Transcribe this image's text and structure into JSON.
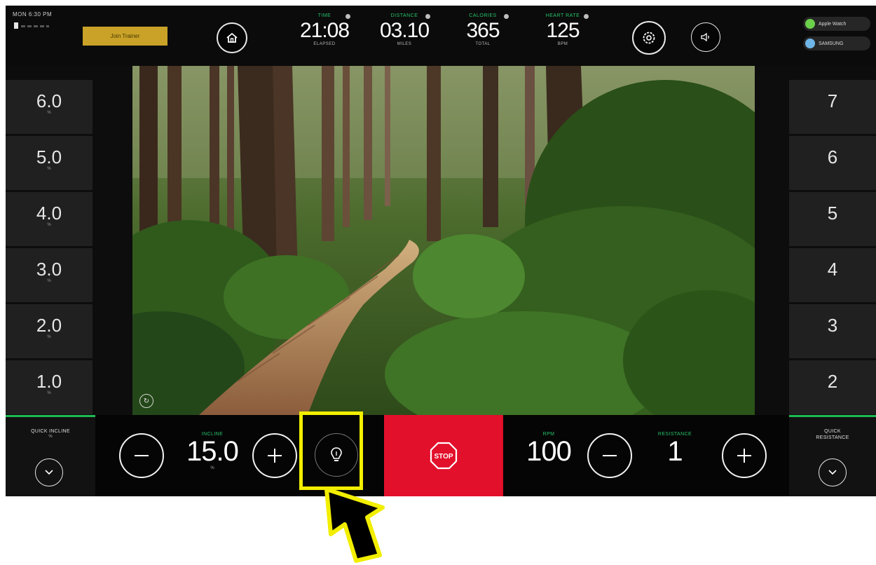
{
  "status": {
    "clock": "MON 6:30 PM"
  },
  "header": {
    "gold_button_label": "Join Trainer",
    "stats": [
      {
        "label": "TIME",
        "value": "21:08",
        "unit": "ELAPSED"
      },
      {
        "label": "DISTANCE",
        "value": "03.10",
        "unit": "MILES"
      },
      {
        "label": "CALORIES",
        "value": "365",
        "unit": "TOTAL"
      },
      {
        "label": "HEART RATE",
        "value": "125",
        "unit": "BPM"
      }
    ],
    "partners": [
      {
        "name": "Apple Watch",
        "color": "#6bd14b"
      },
      {
        "name": "SAMSUNG",
        "color": "#6fb6e8"
      }
    ]
  },
  "incline_presets": [
    "6.0",
    "5.0",
    "4.0",
    "3.0",
    "2.0",
    "1.0"
  ],
  "resistance_presets": [
    "7",
    "6",
    "5",
    "4",
    "3",
    "2"
  ],
  "scene": {
    "icon": "route-logo-icon"
  },
  "controls": {
    "quick_incline_label": "QUICK INCLINE",
    "quick_incline_unit": "%",
    "incline_label": "INCLINE",
    "incline_value": "15.0",
    "incline_unit": "%",
    "lightbulb": "lightbulb-icon",
    "stop_label": "STOP",
    "rpm_label": "RPM",
    "rpm_value": "100",
    "resistance_label": "RESISTANCE",
    "resistance_value": "1",
    "quick_resistance_label": "QUICK RESISTANCE"
  },
  "colors": {
    "accent_green": "#27c26a",
    "stop_red": "#e3102b",
    "gold": "#c9a227",
    "highlight_yellow": "#f2ee00"
  }
}
